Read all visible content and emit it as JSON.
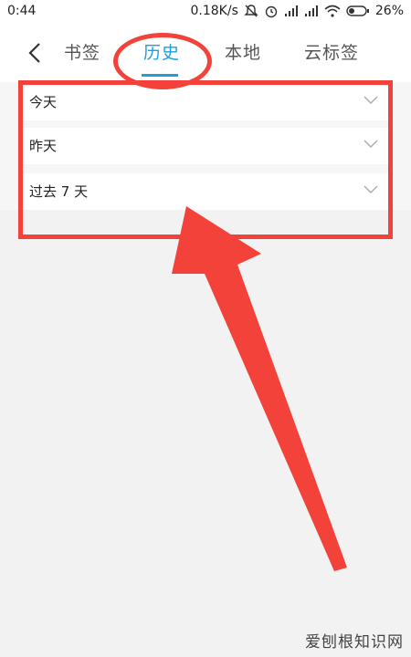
{
  "status_bar": {
    "time": "0:44",
    "network_speed": "0.18K/s",
    "battery": "26%"
  },
  "header": {
    "tabs": [
      {
        "label": "书签"
      },
      {
        "label": "历史"
      },
      {
        "label": "本地"
      },
      {
        "label": "云标签"
      }
    ]
  },
  "history_sections": [
    {
      "label": "今天"
    },
    {
      "label": "昨天"
    },
    {
      "label": "过去 7 天"
    }
  ],
  "annotation": {
    "color": "#f2423a"
  },
  "accent_color": "#1aa0e0",
  "watermark": "爱刨根知识网"
}
